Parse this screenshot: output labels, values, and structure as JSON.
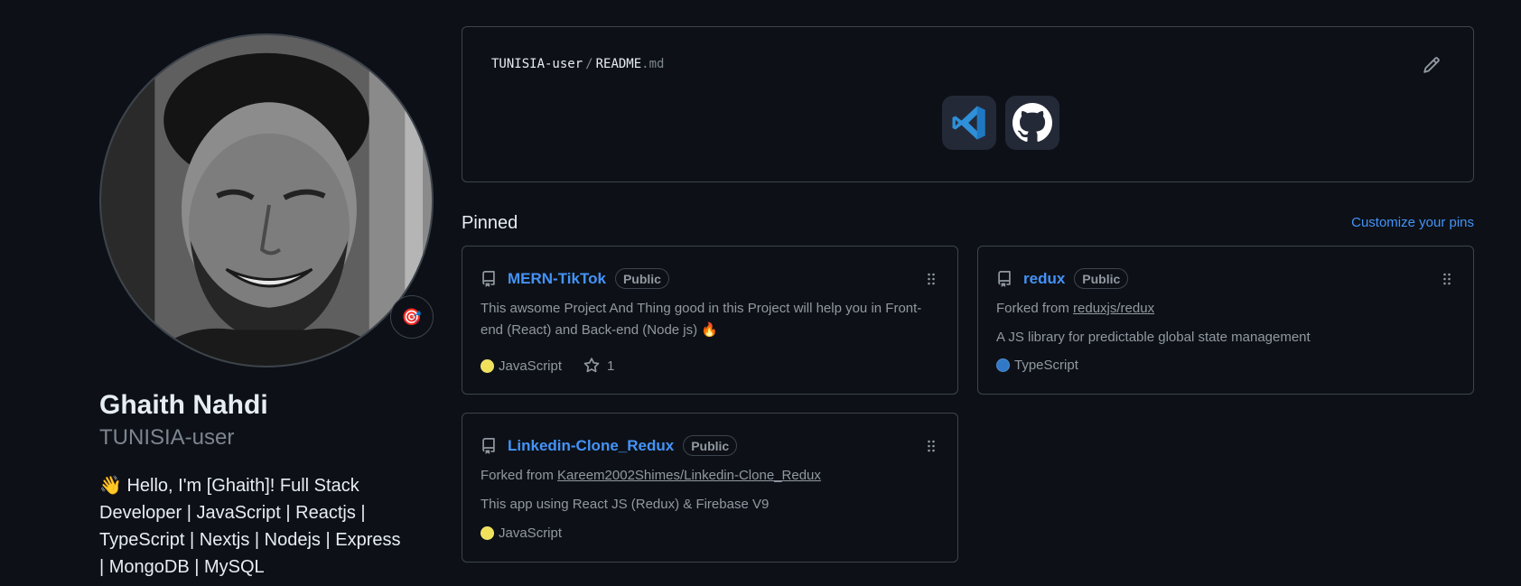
{
  "profile": {
    "full_name": "Ghaith Nahdi",
    "login": "TUNISIA-user",
    "bio": "👋 Hello, I'm [Ghaith]! Full Stack Developer | JavaScript | Reactjs | TypeScript | Nextjs | Nodejs | Express | MongoDB | MySQL",
    "status_emoji": "🎯"
  },
  "readme": {
    "user": "TUNISIA-user",
    "separator": "/",
    "file": "README",
    "ext": ".md",
    "tools": [
      "vscode-icon",
      "github-icon"
    ]
  },
  "pinned": {
    "title": "Pinned",
    "customize_label": "Customize your pins",
    "repos": [
      {
        "name": "MERN-TikTok",
        "visibility": "Public",
        "description": "This awsome Project And Thing good in this Project will help you in Front-end (React) and Back-end (Node js) 🔥",
        "language": "JavaScript",
        "language_color": "#f1e05a",
        "stars": "1"
      },
      {
        "name": "redux",
        "visibility": "Public",
        "forked_prefix": "Forked from",
        "forked_from": "reduxjs/redux",
        "description": "A JS library for predictable global state management",
        "language": "TypeScript",
        "language_color": "#3178c6"
      },
      {
        "name": "Linkedin-Clone_Redux",
        "visibility": "Public",
        "forked_prefix": "Forked from",
        "forked_from": "Kareem2002Shimes/Linkedin-Clone_Redux",
        "description": "This app using React JS (Redux) & Firebase V9",
        "language": "JavaScript",
        "language_color": "#f1e05a"
      }
    ]
  },
  "colors": {
    "background": "#0d1117",
    "border": "#3d444d",
    "link": "#4493f8",
    "muted": "#9198a1"
  }
}
